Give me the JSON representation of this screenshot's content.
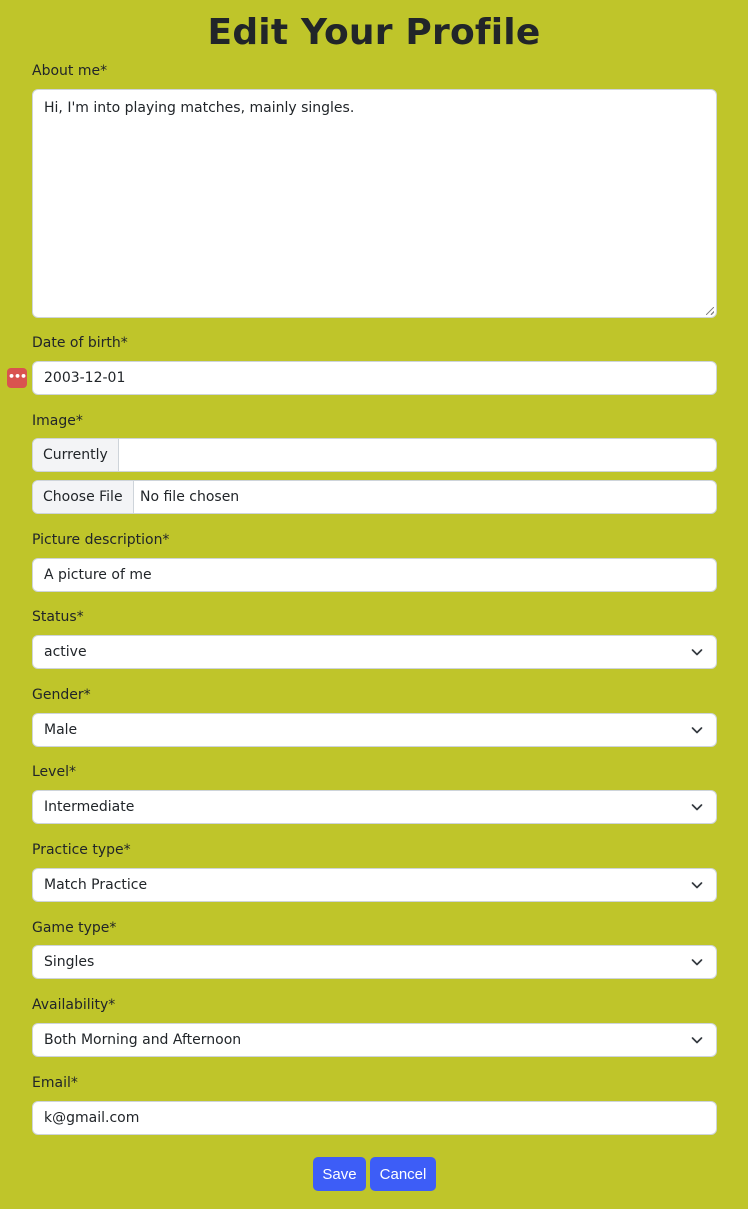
{
  "page": {
    "title": "Edit Your Profile"
  },
  "about": {
    "label": "About me*",
    "value": "Hi, I'm into playing matches, mainly singles."
  },
  "dob": {
    "label": "Date of birth*",
    "value": "2003-12-01"
  },
  "image": {
    "label": "Image*",
    "currently_label": "Currently",
    "currently_value": "",
    "choose_file_label": "Choose File",
    "file_status": "No file chosen"
  },
  "picture_description": {
    "label": "Picture description*",
    "value": "A picture of me"
  },
  "status": {
    "label": "Status*",
    "value": "active"
  },
  "gender": {
    "label": "Gender*",
    "value": "Male"
  },
  "level": {
    "label": "Level*",
    "value": "Intermediate"
  },
  "practice_type": {
    "label": "Practice type*",
    "value": "Match Practice"
  },
  "game_type": {
    "label": "Game type*",
    "value": "Singles"
  },
  "availability": {
    "label": "Availability*",
    "value": "Both Morning and Afternoon"
  },
  "email": {
    "label": "Email*",
    "value": "k@gmail.com"
  },
  "actions": {
    "save_label": "Save",
    "cancel_label": "Cancel"
  },
  "colors": {
    "background": "#bfc52a",
    "button": "#3d5df7",
    "password_manager_icon": "#d9534f"
  },
  "icons": {
    "select_indicator": "chevron-down-icon",
    "password_manager": "password-manager-icon"
  }
}
